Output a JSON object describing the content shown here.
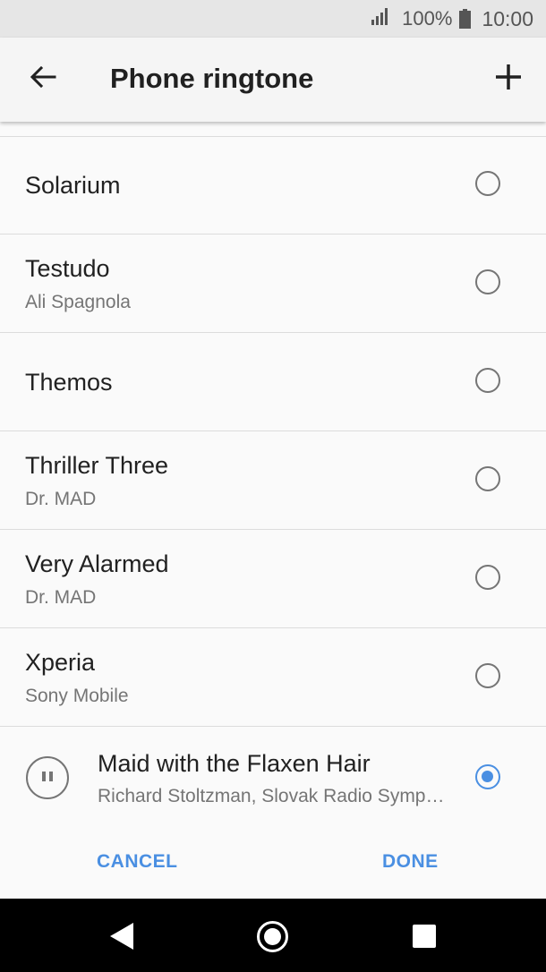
{
  "status_bar": {
    "battery_percent": "100%",
    "time": "10:00",
    "icons": [
      "signal-icon",
      "battery-icon"
    ]
  },
  "header": {
    "title": "Phone ringtone",
    "back_icon": "arrow-left-icon",
    "add_icon": "plus-icon"
  },
  "ringtones": [
    {
      "name": "Solarium",
      "artist": "",
      "selected": false
    },
    {
      "name": "Testudo",
      "artist": "Ali Spagnola",
      "selected": false
    },
    {
      "name": "Themos",
      "artist": "",
      "selected": false
    },
    {
      "name": "Thriller Three",
      "artist": "Dr. MAD",
      "selected": false
    },
    {
      "name": "Very Alarmed",
      "artist": "Dr. MAD",
      "selected": false
    },
    {
      "name": "Xperia",
      "artist": "Sony Mobile",
      "selected": false
    }
  ],
  "now_playing": {
    "title": "Maid with the Flaxen Hair",
    "artist": "Richard Stoltzman, Slovak Radio Symphony Orchestra",
    "selected": true,
    "icon": "pause-icon"
  },
  "actions": {
    "cancel_label": "CANCEL",
    "done_label": "DONE"
  },
  "colors": {
    "accent": "#4a8fe2",
    "background": "#fafafa",
    "status_bar": "#e6e6e6",
    "nav_bar": "#000000"
  },
  "nav_bar": {
    "icons": [
      "nav-back-icon",
      "nav-home-icon",
      "nav-recents-icon"
    ]
  }
}
